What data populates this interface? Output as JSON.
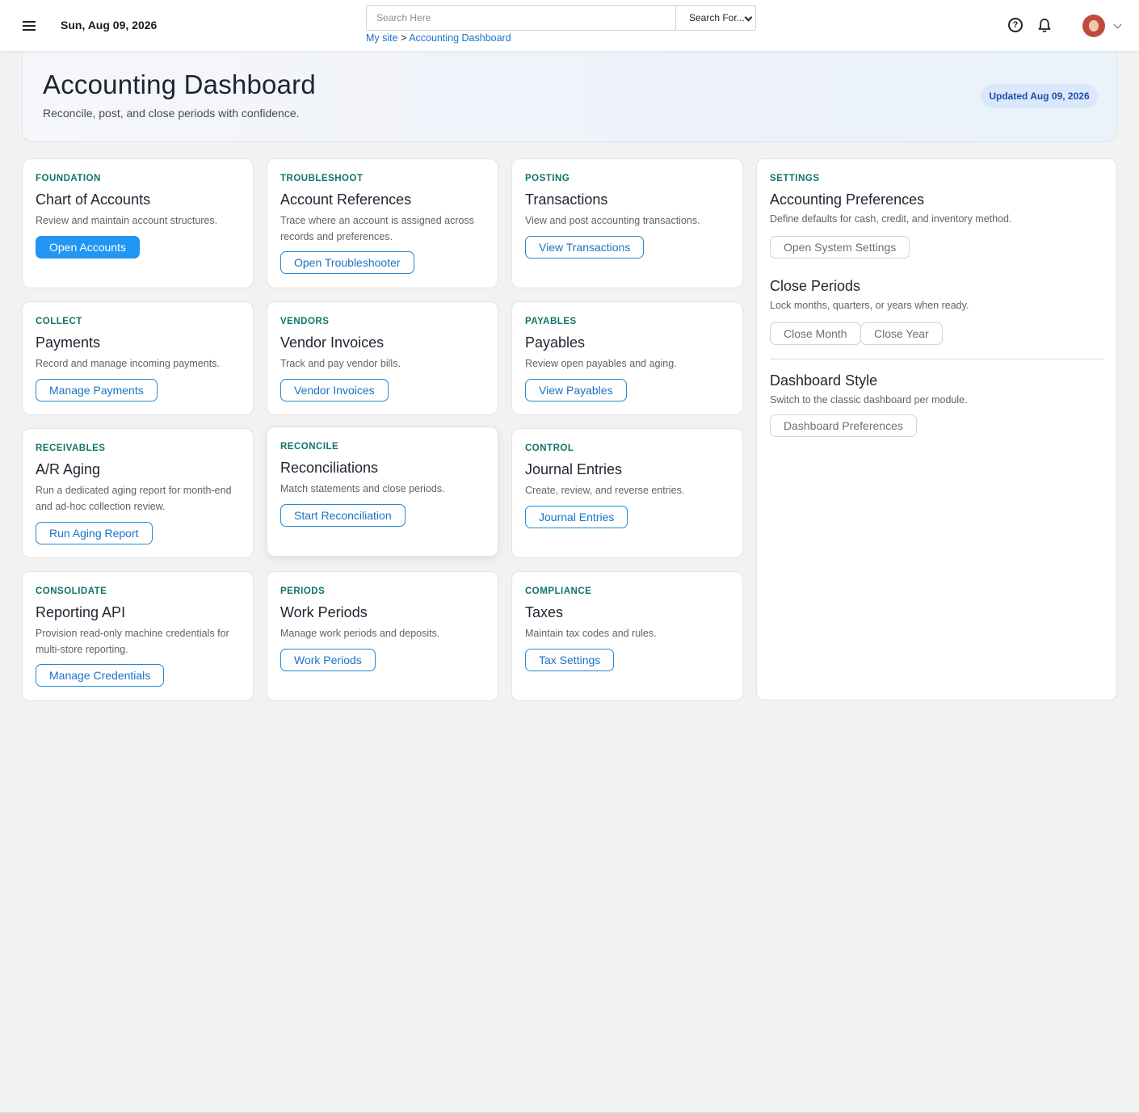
{
  "topbar": {
    "date": "Sun, Aug 09, 2026",
    "search_placeholder": "Search Here",
    "search_select": "Search For...",
    "breadcrumb": {
      "root": "My site",
      "separator": ">",
      "current": "Accounting Dashboard"
    },
    "help_icon": "?",
    "icons": [
      "menu-icon",
      "help-icon",
      "bell-icon",
      "avatar",
      "chevron-down-icon"
    ]
  },
  "hero": {
    "title": "Accounting Dashboard",
    "subtitle": "Reconcile, post, and close periods with confidence.",
    "badge": "Updated Aug 09, 2026"
  },
  "cards": [
    {
      "eyebrow": "FOUNDATION",
      "title": "Chart of Accounts",
      "desc": "Review and maintain account structures.",
      "button": "Open Accounts"
    },
    {
      "eyebrow": "TROUBLESHOOT",
      "title": "Account References",
      "desc": "Trace where an account is assigned across records and preferences.",
      "button": "Open Troubleshooter"
    },
    {
      "eyebrow": "POSTING",
      "title": "Transactions",
      "desc": "View and post accounting transactions.",
      "button": "View Transactions"
    },
    {
      "eyebrow": "COLLECT",
      "title": "Payments",
      "desc": "Record and manage incoming payments.",
      "button": "Manage Payments"
    },
    {
      "eyebrow": "VENDORS",
      "title": "Vendor Invoices",
      "desc": "Track and pay vendor bills.",
      "button": "Vendor Invoices"
    },
    {
      "eyebrow": "PAYABLES",
      "title": "Payables",
      "desc": "Review open payables and aging.",
      "button": "View Payables"
    },
    {
      "eyebrow": "RECEIVABLES",
      "title": "A/R Aging",
      "desc": "Run a dedicated aging report for month-end and ad-hoc collection review.",
      "button": "Run Aging Report"
    },
    {
      "eyebrow": "RECONCILE",
      "title": "Reconciliations",
      "desc": "Match statements and close periods.",
      "button": "Start Reconciliation"
    },
    {
      "eyebrow": "CONTROL",
      "title": "Journal Entries",
      "desc": "Create, review, and reverse entries.",
      "button": "Journal Entries"
    },
    {
      "eyebrow": "CONSOLIDATE",
      "title": "Reporting API",
      "desc": "Provision read-only machine credentials for multi-store reporting.",
      "button": "Manage Credentials"
    },
    {
      "eyebrow": "PERIODS",
      "title": "Work Periods",
      "desc": "Manage work periods and deposits.",
      "button": "Work Periods"
    },
    {
      "eyebrow": "COMPLIANCE",
      "title": "Taxes",
      "desc": "Maintain tax codes and rules.",
      "button": "Tax Settings"
    }
  ],
  "settings": {
    "eyebrow": "SETTINGS",
    "prefs_title": "Accounting Preferences",
    "prefs_desc": "Define defaults for cash, credit, and inventory method.",
    "prefs_button": "Open System Settings",
    "close_title": "Close Periods",
    "close_desc": "Lock months, quarters, or years when ready.",
    "close_month": "Close Month",
    "close_year": "Close Year",
    "style_title": "Dashboard Style",
    "style_desc": "Switch to the classic dashboard per module.",
    "style_button": "Dashboard Preferences"
  },
  "colors": {
    "accent": "#2196f3",
    "link": "#1a73c7",
    "eyebrow": "#0f7468",
    "badge_bg": "#dbe7fb",
    "badge_text": "#1d4fa8"
  }
}
